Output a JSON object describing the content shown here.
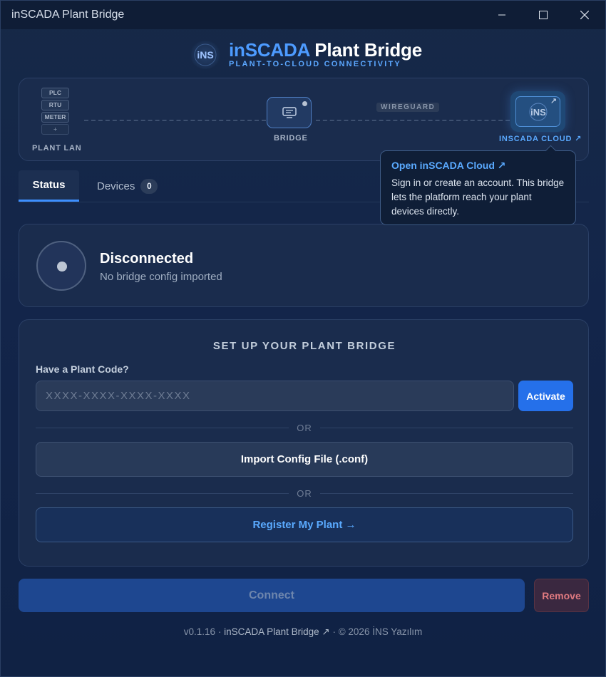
{
  "window": {
    "title": "inSCADA Plant Bridge",
    "controls": {
      "minimize": "minimize-icon",
      "maximize": "maximize-icon",
      "close": "close-icon"
    }
  },
  "header": {
    "logo_text": "iNS",
    "brand_part1": "inSCADA",
    "brand_part2": "Plant Bridge",
    "tagline": "PLANT-TO-CLOUD CONNECTIVITY"
  },
  "topology": {
    "devices": [
      "PLC",
      "RTU",
      "METER",
      "+"
    ],
    "plant_label": "PLANT LAN",
    "bridge_label": "BRIDGE",
    "tunnel_label": "WIREGUARD",
    "cloud_label": "INSCADA CLOUD ↗",
    "cloud_icon_text": "iNS",
    "cloud_arrow": "↗"
  },
  "tooltip": {
    "title": "Open inSCADA Cloud ↗",
    "body": "Sign in or create an account. This bridge lets the platform reach your plant devices directly."
  },
  "tabs": {
    "status": "Status",
    "devices": "Devices",
    "devices_count": "0"
  },
  "status": {
    "title": "Disconnected",
    "subtitle": "No bridge config imported"
  },
  "setup": {
    "title": "SET UP YOUR PLANT BRIDGE",
    "code_label": "Have a Plant Code?",
    "code_placeholder": "XXXX-XXXX-XXXX-XXXX",
    "code_value": "",
    "activate": "Activate",
    "or1": "OR",
    "import": "Import Config File (.conf)",
    "or2": "OR",
    "register": "Register My Plant →"
  },
  "actions": {
    "connect": "Connect",
    "remove": "Remove"
  },
  "footer": {
    "version": "v0.1.16",
    "sep1": " · ",
    "link": "inSCADA Plant Bridge ↗",
    "sep2": " · ",
    "copyright": "© 2026 İNS Yazılım"
  },
  "colors": {
    "accent": "#2570ea",
    "link": "#5aaaff",
    "danger": "#e07a80",
    "background": "#13254a"
  }
}
